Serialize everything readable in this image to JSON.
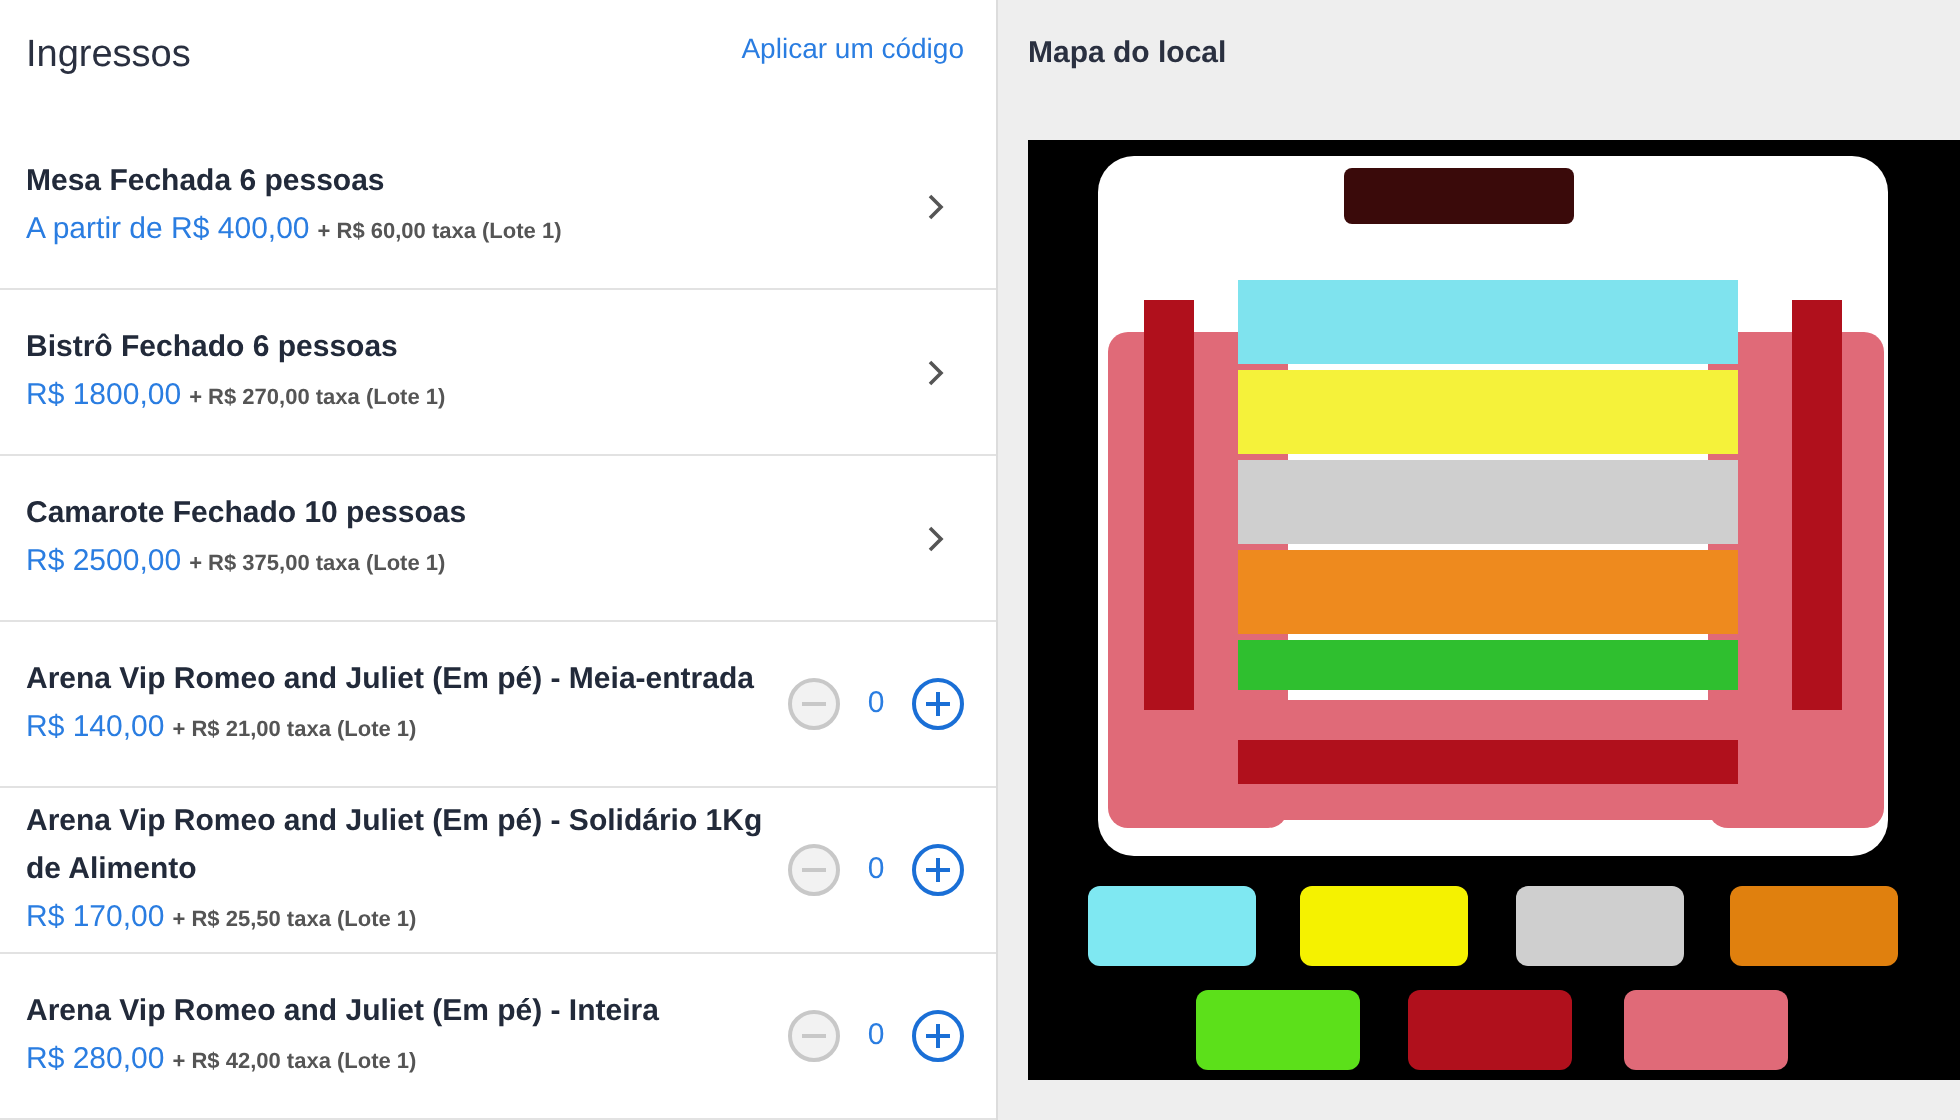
{
  "tickets_panel": {
    "title": "Ingressos",
    "code_link": "Aplicar um código",
    "tickets": [
      {
        "kind": "link",
        "name": "Mesa Fechada 6 pessoas",
        "price": "A partir de R$ 400,00",
        "fee": "+ R$ 60,00 taxa (Lote 1)"
      },
      {
        "kind": "link",
        "name": "Bistrô Fechado 6 pessoas",
        "price": "R$ 1800,00",
        "fee": "+ R$ 270,00 taxa (Lote 1)"
      },
      {
        "kind": "link",
        "name": "Camarote Fechado 10 pessoas",
        "price": "R$ 2500,00",
        "fee": "+ R$ 375,00 taxa (Lote 1)"
      },
      {
        "kind": "counter",
        "name": "Arena Vip Romeo and Juliet (Em pé) - Meia-entrada",
        "price": "R$ 140,00",
        "fee": "+ R$ 21,00 taxa (Lote 1)",
        "quantity": "0",
        "minus_disabled": true
      },
      {
        "kind": "counter",
        "name": "Arena Vip Romeo and Juliet (Em pé) - Solidário 1Kg de Alimento",
        "price": "R$ 170,00",
        "fee": "+ R$ 25,50 taxa (Lote 1)",
        "quantity": "0",
        "minus_disabled": true
      },
      {
        "kind": "counter",
        "name": "Arena Vip Romeo and Juliet (Em pé) - Inteira",
        "price": "R$ 280,00",
        "fee": "+ R$ 42,00 taxa (Lote 1)",
        "quantity": "0",
        "minus_disabled": true
      }
    ]
  },
  "map_panel": {
    "title": "Mapa do local"
  }
}
